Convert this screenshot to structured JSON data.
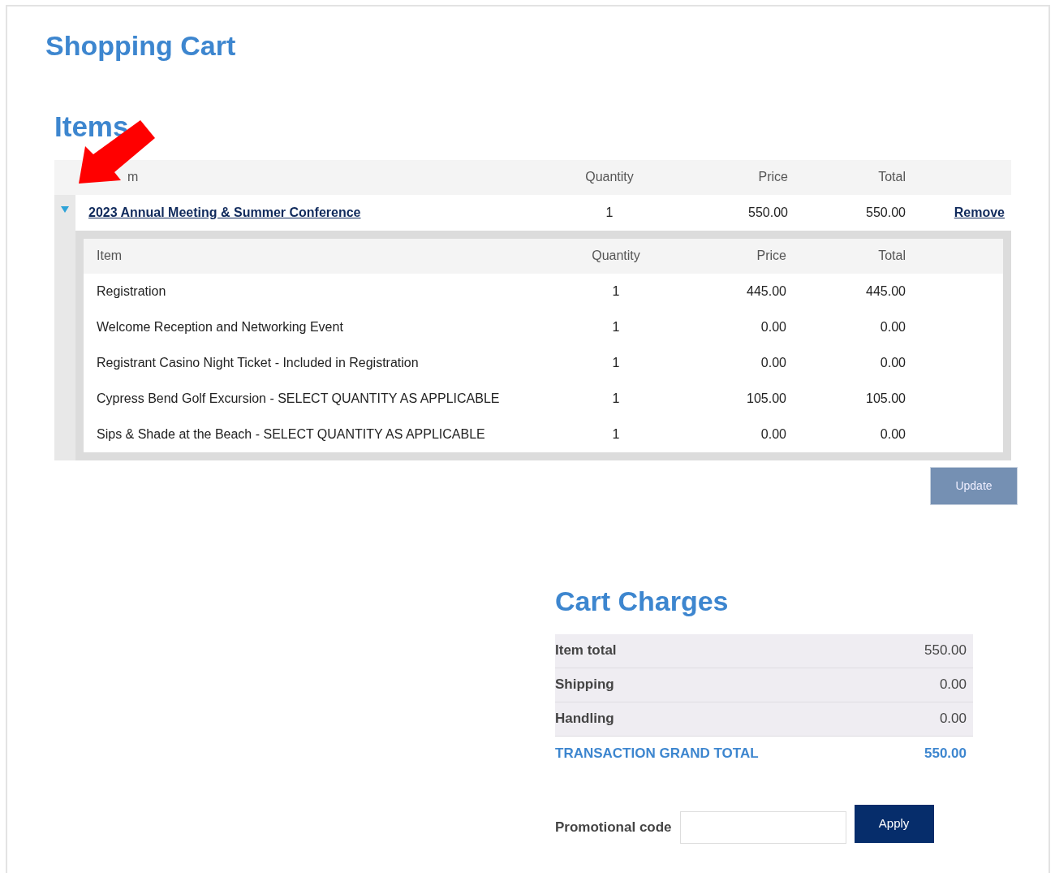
{
  "title": "Shopping Cart",
  "items_section": {
    "heading": "Items",
    "columns": [
      "m",
      "Quantity",
      "Price",
      "Total"
    ],
    "rows": [
      {
        "name": "2023 Annual Meeting & Summer Conference",
        "quantity": "1",
        "price": "550.00",
        "total": "550.00",
        "remove": "Remove",
        "expanded": true,
        "detail": {
          "columns": [
            "Item",
            "Quantity",
            "Price",
            "Total"
          ],
          "rows": [
            {
              "item": "Registration",
              "quantity": "1",
              "price": "445.00",
              "total": "445.00"
            },
            {
              "item": "Welcome Reception and Networking Event",
              "quantity": "1",
              "price": "0.00",
              "total": "0.00"
            },
            {
              "item": "Registrant Casino Night Ticket - Included in Registration",
              "quantity": "1",
              "price": "0.00",
              "total": "0.00"
            },
            {
              "item": "Cypress Bend Golf Excursion - SELECT QUANTITY AS APPLICABLE",
              "quantity": "1",
              "price": "105.00",
              "total": "105.00"
            },
            {
              "item": "Sips & Shade at the Beach - SELECT QUANTITY AS APPLICABLE",
              "quantity": "1",
              "price": "0.00",
              "total": "0.00"
            }
          ]
        }
      }
    ],
    "update_button": "Update"
  },
  "cart_charges": {
    "heading": "Cart Charges",
    "rows": [
      {
        "label": "Item total",
        "value": "550.00",
        "kind": "line"
      },
      {
        "label": "Shipping",
        "value": "0.00",
        "kind": "line"
      },
      {
        "label": "Handling",
        "value": "0.00",
        "kind": "line"
      },
      {
        "label": "TRANSACTION GRAND TOTAL",
        "value": "550.00",
        "kind": "grand"
      }
    ],
    "promo_label": "Promotional code",
    "apply_button": "Apply"
  }
}
